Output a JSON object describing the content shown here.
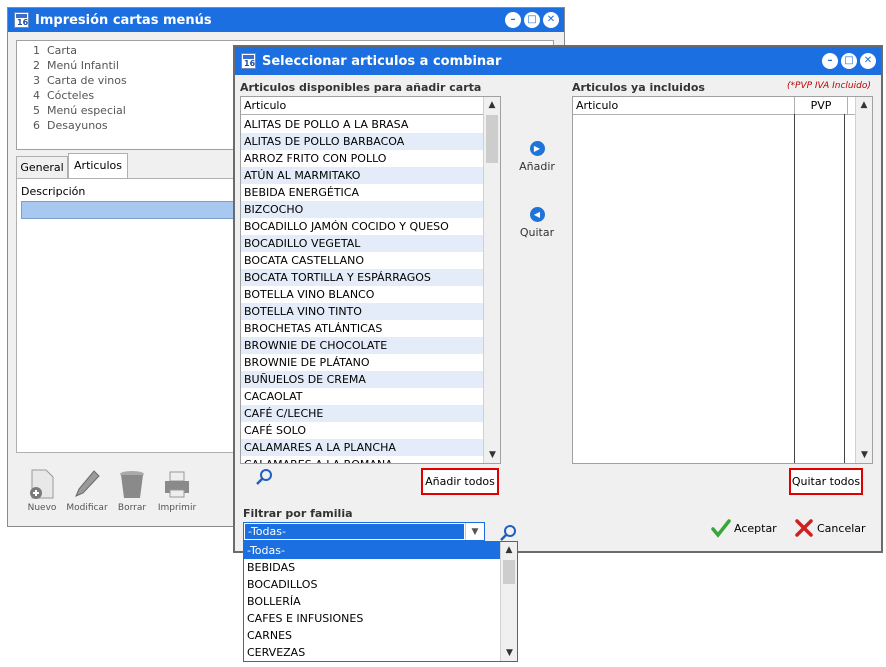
{
  "back": {
    "title": "Impresión cartas menús",
    "menu_items": [
      {
        "num": "1",
        "label": "Carta"
      },
      {
        "num": "2",
        "label": "Menú Infantil"
      },
      {
        "num": "3",
        "label": "Carta de vinos"
      },
      {
        "num": "4",
        "label": "Cócteles"
      },
      {
        "num": "5",
        "label": "Menú especial"
      },
      {
        "num": "6",
        "label": "Desayunos"
      }
    ],
    "tabs": [
      "General",
      "Articulos"
    ],
    "active_tab": "Articulos",
    "col_descripcion": "Descripción",
    "toolbar": {
      "nuevo": "Nuevo",
      "modificar": "Modificar",
      "borrar": "Borrar",
      "imprimir": "Imprimir"
    }
  },
  "dialog": {
    "title": "Seleccionar articulos a combinar",
    "available_heading": "Articulos disponibles para añadir carta",
    "included_heading": "Articulos ya incluidos",
    "pvp_note": "(*PVP IVA Incluido)",
    "col_articulo": "Articulo",
    "col_pvp": "PVP",
    "available": [
      "ALITAS DE POLLO A LA BRASA",
      "ALITAS DE POLLO BARBACOA",
      "ARROZ FRITO CON POLLO",
      "ATÚN AL MARMITAKO",
      "BEBIDA ENERGÉTICA",
      "BIZCOCHO",
      "BOCADILLO JAMÓN COCIDO Y QUESO",
      "BOCADILLO VEGETAL",
      "BOCATA CASTELLANO",
      "BOCATA TORTILLA Y ESPÁRRAGOS",
      "BOTELLA VINO BLANCO",
      "BOTELLA VINO TINTO",
      "BROCHETAS ATLÁNTICAS",
      "BROWNIE DE CHOCOLATE",
      "BROWNIE DE PLÁTANO",
      "BUÑUELOS DE CREMA",
      "CACAOLAT",
      "CAFÉ C/LECHE",
      "CAFÉ SOLO",
      "CALAMARES A LA PLANCHA",
      "CALAMARES A LA ROMANA"
    ],
    "btn_add": "Añadir",
    "btn_remove": "Quitar",
    "btn_add_all": "Añadir todos",
    "btn_remove_all": "Quitar todos",
    "filter_label": "Filtrar por familia",
    "filter_value": "-Todas-",
    "filter_options": [
      "-Todas-",
      "BEBIDAS",
      "BOCADILLOS",
      "BOLLERÍA",
      "CAFES E INFUSIONES",
      "CARNES",
      "CERVEZAS"
    ],
    "btn_accept": "Aceptar",
    "btn_cancel": "Cancelar"
  },
  "colors": {
    "titlebar": "#1c6fe0",
    "alt_row": "#e3ecf8",
    "highlight_box": "#e00000"
  }
}
